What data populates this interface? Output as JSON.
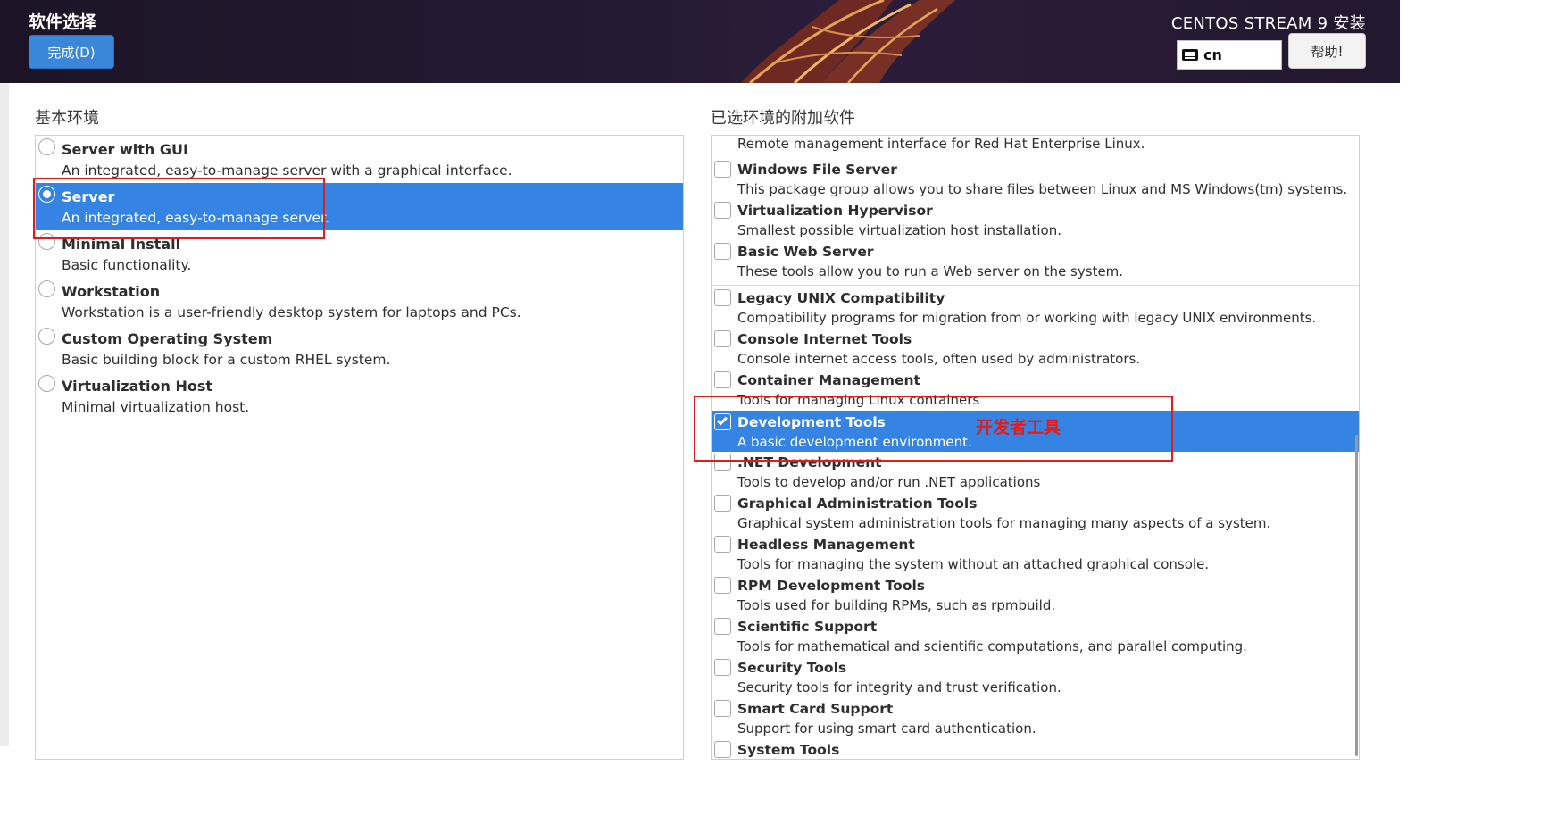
{
  "header": {
    "page_title": "软件选择",
    "done_label": "完成(D)",
    "product_title": "CENTOS STREAM 9 安装",
    "keyboard_layout": "cn",
    "help_label": "帮助!"
  },
  "left": {
    "section_label": "基本环境",
    "environments": [
      {
        "name": "Server with GUI",
        "desc": "An integrated, easy-to-manage server with a graphical interface.",
        "selected": false
      },
      {
        "name": "Server",
        "desc": "An integrated, easy-to-manage server.",
        "selected": true
      },
      {
        "name": "Minimal Install",
        "desc": "Basic functionality.",
        "selected": false
      },
      {
        "name": "Workstation",
        "desc": "Workstation is a user-friendly desktop system for laptops and PCs.",
        "selected": false
      },
      {
        "name": "Custom Operating System",
        "desc": "Basic building block for a custom RHEL system.",
        "selected": false
      },
      {
        "name": "Virtualization Host",
        "desc": "Minimal virtualization host.",
        "selected": false
      }
    ]
  },
  "right": {
    "section_label": "已选环境的附加软件",
    "partial_top_desc": "Remote management interface for Red Hat Enterprise Linux.",
    "addons": [
      {
        "name": "Windows File Server",
        "desc": "This package group allows you to share files between Linux and MS Windows(tm) systems.",
        "checked": false
      },
      {
        "name": "Virtualization Hypervisor",
        "desc": "Smallest possible virtualization host installation.",
        "checked": false
      },
      {
        "name": "Basic Web Server",
        "desc": "These tools allow you to run a Web server on the system.",
        "checked": false
      },
      {
        "name": "Legacy UNIX Compatibility",
        "desc": "Compatibility programs for migration from or working with legacy UNIX environments.",
        "checked": false
      },
      {
        "name": "Console Internet Tools",
        "desc": "Console internet access tools, often used by administrators.",
        "checked": false
      },
      {
        "name": "Container Management",
        "desc": "Tools for managing Linux containers",
        "checked": false
      },
      {
        "name": "Development Tools",
        "desc": "A basic development environment.",
        "checked": true
      },
      {
        "name": ".NET Development",
        "desc": "Tools to develop and/or run .NET applications",
        "checked": false
      },
      {
        "name": "Graphical Administration Tools",
        "desc": "Graphical system administration tools for managing many aspects of a system.",
        "checked": false
      },
      {
        "name": "Headless Management",
        "desc": "Tools for managing the system without an attached graphical console.",
        "checked": false
      },
      {
        "name": "RPM Development Tools",
        "desc": "Tools used for building RPMs, such as rpmbuild.",
        "checked": false
      },
      {
        "name": "Scientific Support",
        "desc": "Tools for mathematical and scientific computations, and parallel computing.",
        "checked": false
      },
      {
        "name": "Security Tools",
        "desc": "Security tools for integrity and trust verification.",
        "checked": false
      },
      {
        "name": "Smart Card Support",
        "desc": "Support for using smart card authentication.",
        "checked": false
      },
      {
        "name": "System Tools",
        "desc": "",
        "checked": false
      }
    ]
  },
  "annotation": {
    "note_text": "开发者工具",
    "color": "#e41b1b"
  },
  "colors": {
    "selection": "#3584e4",
    "done_button": "#3a86d8"
  }
}
